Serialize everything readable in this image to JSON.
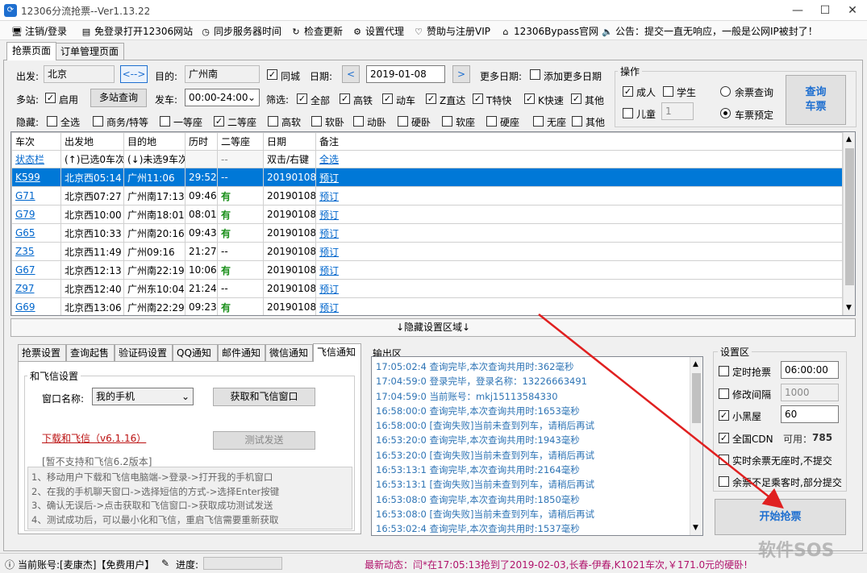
{
  "window": {
    "title": "12306分流抢票--Ver1.13.22",
    "minimize": "—",
    "maximize": "☐",
    "close": "✕"
  },
  "menu": [
    {
      "icon": "monitor-icon",
      "glyph": "🖥",
      "label": "注销/登录"
    },
    {
      "icon": "doc-icon",
      "glyph": "▤",
      "label": "免登录打开12306网站"
    },
    {
      "icon": "clock-icon",
      "glyph": "◷",
      "label": "同步服务器时间"
    },
    {
      "icon": "refresh-icon",
      "glyph": "↻",
      "label": "检查更新"
    },
    {
      "icon": "gear-icon",
      "glyph": "⚙",
      "label": "设置代理"
    },
    {
      "icon": "heart-icon",
      "glyph": "♡",
      "label": "赞助与注册VIP"
    },
    {
      "icon": "home-icon",
      "glyph": "⌂",
      "label": "12306Bypass官网"
    },
    {
      "icon": "speaker-icon",
      "glyph": "🔈",
      "label": "公告：提交一直无响应，一般是公网IP被封了！"
    }
  ],
  "tabs": [
    "抢票页面",
    "订单管理页面"
  ],
  "query": {
    "from_label": "出发:",
    "from_value": "北京",
    "swap_label": "<-->",
    "to_label": "目的:",
    "to_value": "广州南",
    "same_city": "同城",
    "date_label": "日期:",
    "date_value": "2019-01-08",
    "prev": "<",
    "next": ">",
    "more_dates_label": "更多日期:",
    "add_more_dates": "添加更多日期",
    "multi_label": "多站:",
    "enable": "启用",
    "multi_query": "多站查询",
    "depart_label": "发车:",
    "depart_value": "00:00-24:00",
    "filter_label": "筛选:",
    "filters": [
      "全部",
      "高铁",
      "动车",
      "Z直达",
      "T特快",
      "K快速",
      "其他"
    ],
    "hide_label": "隐藏:",
    "hide_items": [
      {
        "label": "全选",
        "checked": false
      },
      {
        "label": "商务/特等",
        "checked": false
      },
      {
        "label": "一等座",
        "checked": false
      },
      {
        "label": "二等座",
        "checked": true
      },
      {
        "label": "高软",
        "checked": false
      },
      {
        "label": "软卧",
        "checked": false
      },
      {
        "label": "动卧",
        "checked": false
      },
      {
        "label": "硬卧",
        "checked": false
      },
      {
        "label": "软座",
        "checked": false
      },
      {
        "label": "硬座",
        "checked": false
      },
      {
        "label": "无座",
        "checked": false
      },
      {
        "label": "其他",
        "checked": false
      }
    ]
  },
  "ops": {
    "title": "操作",
    "adult": "成人",
    "student": "学生",
    "child": "儿童",
    "child_count": "1",
    "remain_query": "余票查询",
    "reserve": "车票预定",
    "query_btn": "查询\n车票"
  },
  "table": {
    "headers": [
      "车次",
      "出发地",
      "目的地",
      "历时",
      "二等座",
      "日期",
      "备注"
    ],
    "status_row": [
      "状态栏",
      "(↑)已选0车次",
      "(↓)未选9车次",
      "",
      "--",
      "双击/右键",
      "全选"
    ],
    "rows": [
      [
        "K599",
        "北京西05:14",
        "广州11:06",
        "29:52",
        "--",
        "20190108",
        "预订"
      ],
      [
        "G71",
        "北京西07:27",
        "广州南17:13",
        "09:46",
        "有",
        "20190108",
        "预订"
      ],
      [
        "G79",
        "北京西10:00",
        "广州南18:01",
        "08:01",
        "有",
        "20190108",
        "预订"
      ],
      [
        "G65",
        "北京西10:33",
        "广州南20:16",
        "09:43",
        "有",
        "20190108",
        "预订"
      ],
      [
        "Z35",
        "北京西11:49",
        "广州09:16",
        "21:27",
        "--",
        "20190108",
        "预订"
      ],
      [
        "G67",
        "北京西12:13",
        "广州南22:19",
        "10:06",
        "有",
        "20190108",
        "预订"
      ],
      [
        "Z97",
        "北京西12:40",
        "广州东10:04",
        "21:24",
        "--",
        "20190108",
        "预订"
      ],
      [
        "G69",
        "北京西13:06",
        "广州南22:29",
        "09:23",
        "有",
        "20190108",
        "预订"
      ]
    ]
  },
  "hide_settings": "↓隐藏设置区域↓",
  "settings_tabs": [
    "抢票设置",
    "查询起售",
    "验证码设置",
    "QQ通知",
    "邮件通知",
    "微信通知",
    "飞信通知"
  ],
  "fetion": {
    "group_title": "和飞信设置",
    "window_name_label": "窗口名称:",
    "window_name_value": "我的手机",
    "get_window_btn": "获取和飞信窗口",
    "download_link": "下载和飞信（v6.1.16）",
    "test_btn": "测试发送",
    "unsupported": "[暂不支持和飞信6.2版本]",
    "steps": [
      "1、移动用户下载和飞信电脑端->登录->打开我的手机窗口",
      "2、在我的手机聊天窗口->选择短信的方式->选择Enter按键",
      "3、确认无误后->点击获取和飞信窗口->获取成功测试发送",
      "4、测试成功后，可以最小化和飞信，重启飞信需要重新获取"
    ]
  },
  "output": {
    "title": "输出区",
    "lines": [
      "17:05:02:4   查询完毕,本次查询共用时:362毫秒",
      "17:04:59:0   登录完毕，登录名称：13226663491",
      "17:04:59:0   当前账号：mkj15113584330",
      "16:58:00:0   查询完毕,本次查询共用时:1653毫秒",
      "16:58:00:0   [查询失败]当前未查到列车，请稍后再试",
      "16:53:20:0   查询完毕,本次查询共用时:1943毫秒",
      "16:53:20:0   [查询失败]当前未查到列车，请稍后再试",
      "16:53:13:1   查询完毕,本次查询共用时:2164毫秒",
      "16:53:13:1   [查询失败]当前未查到列车，请稍后再试",
      "16:53:08:0   查询完毕,本次查询共用时:1850毫秒",
      "16:53:08:0   [查询失败]当前未查到列车，请稍后再试",
      "16:53:02:4   查询完毕,本次查询共用时:1537毫秒"
    ]
  },
  "setup": {
    "title": "设置区",
    "timed": "定时抢票",
    "timed_value": "06:00:00",
    "interval": "修改间隔",
    "interval_value": "1000",
    "blackroom": "小黑屋",
    "blackroom_value": "60",
    "cdn": "全国CDN",
    "cdn_avail_label": "可用：",
    "cdn_avail": "785",
    "no_seat": "实时余票无座时,不提交",
    "partial": "余票不足乘客时,部分提交",
    "start_btn": "开始抢票"
  },
  "status": {
    "account": "当前账号:[麦康杰]【免费用户】",
    "progress_label": "进度:",
    "news": "最新动态：闫*在17:05:13抢到了2019-02-03,长春-伊春,K1021车次,￥171.0元的硬卧!",
    "watermark": "软件SOS"
  }
}
